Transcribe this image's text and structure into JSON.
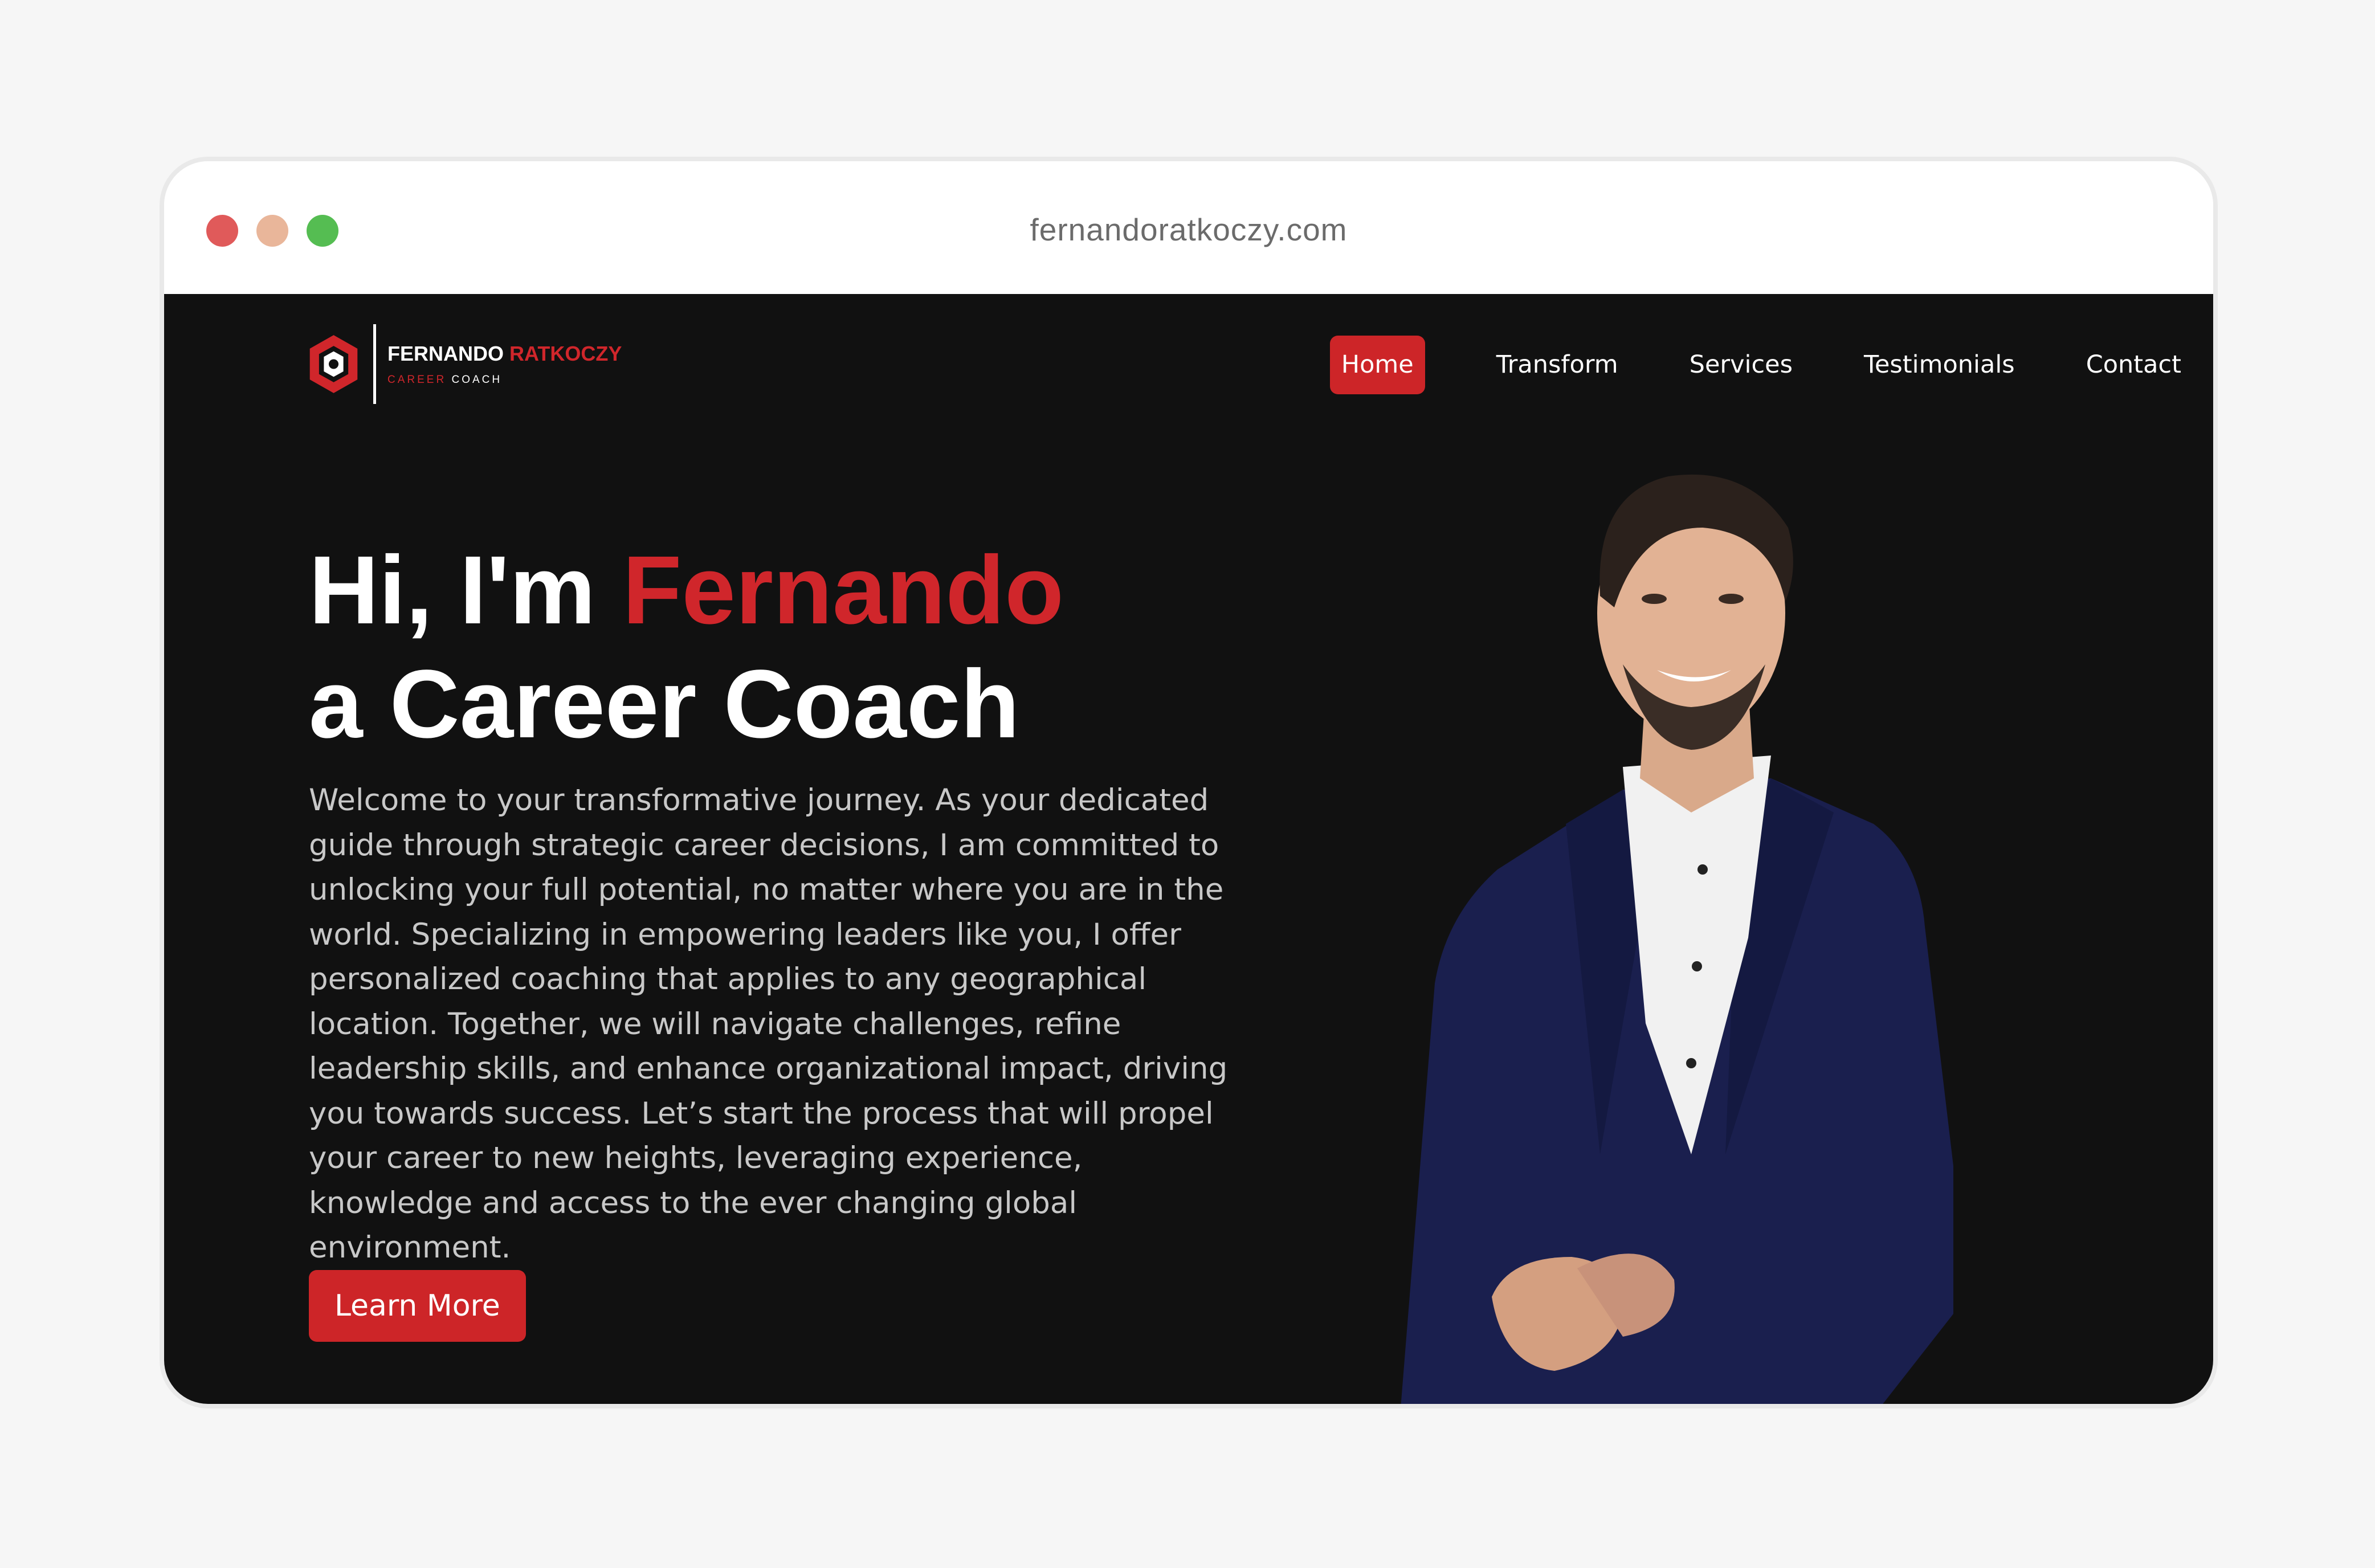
{
  "browser": {
    "url": "fernandoratkoczy.com"
  },
  "logo": {
    "name_first": "FERNANDO",
    "name_last": "RATKOCZY",
    "subtitle_accent": "CAREER",
    "subtitle_rest": "COACH"
  },
  "nav": {
    "items": [
      {
        "label": "Home",
        "active": true
      },
      {
        "label": "Transform",
        "active": false
      },
      {
        "label": "Services",
        "active": false
      },
      {
        "label": "Testimonials",
        "active": false
      },
      {
        "label": "Contact",
        "active": false
      }
    ]
  },
  "hero": {
    "title_prefix": "Hi, I'm",
    "title_name": "Fernando",
    "title_line2": "a Career Coach",
    "body": "Welcome to your transformative journey. As your dedicated guide through strategic career decisions, I am committed to unlocking your full potential, no matter where you are in the world. Specializing in empowering leaders like you, I offer personalized coaching that applies to any geographical location. Together, we will navigate challenges, refine leadership skills, and enhance organizational impact, driving you towards success. Let’s start the process that will propel your career to new heights, leveraging experience, knowledge and access to the ever changing global environment.",
    "cta_label": "Learn More"
  },
  "colors": {
    "accent": "#cd2528",
    "background": "#111111",
    "text": "#ffffff",
    "body_text": "#c8c8c8"
  }
}
